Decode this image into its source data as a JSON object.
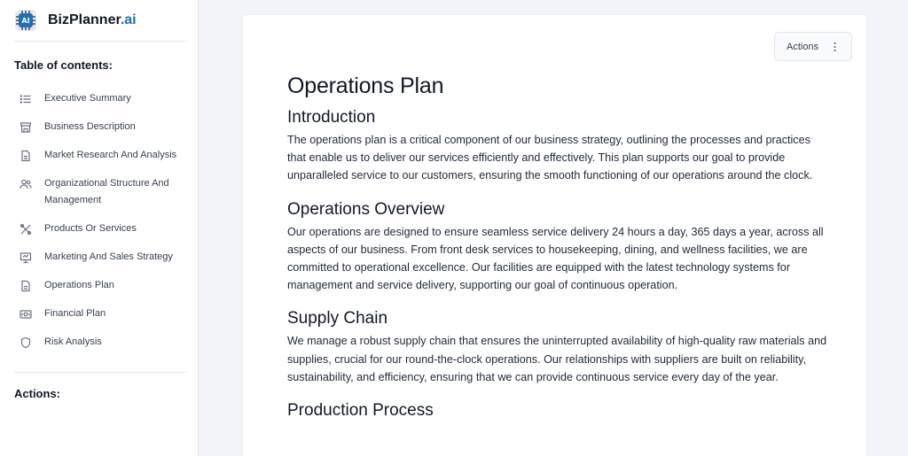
{
  "brand": {
    "name": "BizPlanner",
    "suffix": ".ai",
    "logo_text": "AI"
  },
  "sidebar": {
    "toc_heading": "Table of contents:",
    "items": [
      {
        "label": "Executive Summary",
        "icon": "list-icon"
      },
      {
        "label": "Business Description",
        "icon": "store-icon"
      },
      {
        "label": "Market Research And Analysis",
        "icon": "document-icon"
      },
      {
        "label": "Organizational Structure And Management",
        "icon": "users-icon"
      },
      {
        "label": "Products Or Services",
        "icon": "tools-icon"
      },
      {
        "label": "Marketing And Sales Strategy",
        "icon": "presentation-icon"
      },
      {
        "label": "Operations Plan",
        "icon": "document-icon"
      },
      {
        "label": "Financial Plan",
        "icon": "money-icon"
      },
      {
        "label": "Risk Analysis",
        "icon": "shield-icon"
      }
    ],
    "actions_heading": "Actions:"
  },
  "toolbar": {
    "actions_label": "Actions"
  },
  "document": {
    "title": "Operations Plan",
    "sections": [
      {
        "heading": "Introduction",
        "body": "The operations plan is a critical component of our business strategy, outlining the processes and practices that enable us to deliver our services efficiently and effectively. This plan supports our goal to provide unparalleled service to our customers, ensuring the smooth functioning of our operations around the clock."
      },
      {
        "heading": "Operations Overview",
        "body": "Our operations are designed to ensure seamless service delivery 24 hours a day, 365 days a year, across all aspects of our business. From front desk services to housekeeping, dining, and wellness facilities, we are committed to operational excellence. Our facilities are equipped with the latest technology systems for management and service delivery, supporting our goal of continuous operation."
      },
      {
        "heading": "Supply Chain",
        "body": "We manage a robust supply chain that ensures the uninterrupted availability of high-quality raw materials and supplies, crucial for our round-the-clock operations. Our relationships with suppliers are built on reliability, sustainability, and efficiency, ensuring that we can provide continuous service every day of the year."
      },
      {
        "heading": "Production Process",
        "body": ""
      }
    ]
  },
  "colors": {
    "accent": "#1e6fb8",
    "page_bg": "#f3f4f6",
    "text": "#111827"
  }
}
